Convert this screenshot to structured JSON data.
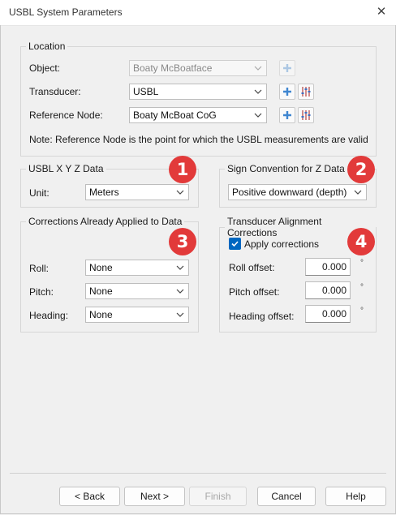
{
  "window": {
    "title": "USBL System Parameters"
  },
  "location": {
    "legend": "Location",
    "object_label": "Object:",
    "object_value": "Boaty McBoatface",
    "transducer_label": "Transducer:",
    "transducer_value": "USBL",
    "reference_label": "Reference Node:",
    "reference_value": "Boaty McBoat CoG",
    "note": "Note: Reference Node is the point for which the USBL measurements are valid"
  },
  "xyz": {
    "legend": "USBL X Y Z Data",
    "unit_label": "Unit:",
    "unit_value": "Meters",
    "badge": "1"
  },
  "sign": {
    "legend": "Sign Convention for Z Data",
    "value": "Positive downward (depth)",
    "badge": "2"
  },
  "corrections": {
    "legend": "Corrections Already Applied to Data",
    "badge": "3",
    "roll_label": "Roll:",
    "roll_value": "None",
    "pitch_label": "Pitch:",
    "pitch_value": "None",
    "heading_label": "Heading:",
    "heading_value": "None"
  },
  "alignment": {
    "legend": "Transducer Alignment Corrections",
    "badge": "4",
    "apply_label": "Apply corrections",
    "apply_checked": true,
    "roll_label": "Roll offset:",
    "roll_value": "0.000",
    "pitch_label": "Pitch offset:",
    "pitch_value": "0.000",
    "heading_label": "Heading offset:",
    "heading_value": "0.000",
    "unit": "°"
  },
  "buttons": {
    "back": "< Back",
    "next": "Next >",
    "finish": "Finish",
    "cancel": "Cancel",
    "help": "Help"
  },
  "colors": {
    "badge": "#e23a3a",
    "accent": "#0067c0"
  }
}
